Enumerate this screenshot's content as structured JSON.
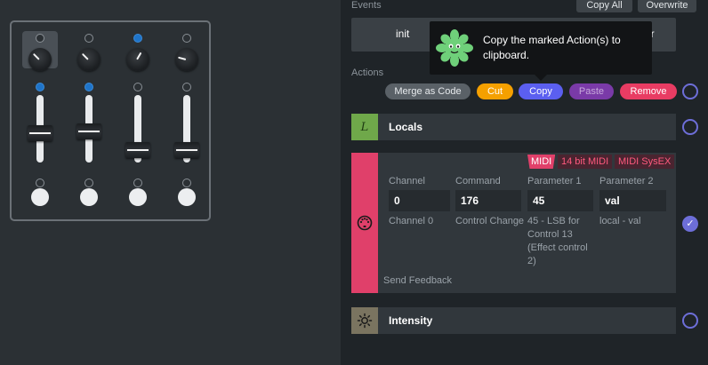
{
  "mixer": {
    "channels": [
      {
        "top_led": "off",
        "knob_angle": -135,
        "knob_selected": true,
        "fader_level": 0.45,
        "bottom_led": "off"
      },
      {
        "top_led": "off",
        "knob_angle": -135,
        "knob_selected": false,
        "fader_level": 0.42,
        "bottom_led": "off"
      },
      {
        "top_led": "on",
        "knob_angle": -60,
        "knob_selected": false,
        "fader_level": 0.15,
        "bottom_led": "off"
      },
      {
        "top_led": "off",
        "knob_angle": -165,
        "knob_selected": false,
        "fader_level": 0.15,
        "bottom_led": "off"
      }
    ],
    "fader_leds": [
      "on",
      "on",
      "off",
      "off"
    ]
  },
  "events": {
    "label": "Events",
    "copy_all_label": "Copy All",
    "overwrite_label": "Overwrite",
    "items": [
      "init",
      "timer"
    ]
  },
  "tooltip": {
    "text": "Copy the marked Action(s) to clipboard."
  },
  "actions": {
    "label": "Actions",
    "toolbar": {
      "merge_label": "Merge as Code",
      "cut_label": "Cut",
      "copy_label": "Copy",
      "paste_label": "Paste",
      "remove_label": "Remove"
    },
    "locals": {
      "title": "Locals",
      "icon": "L"
    },
    "midi": {
      "tabs": [
        "MIDI",
        "14 bit MIDI",
        "MIDI SysEX"
      ],
      "fields": [
        {
          "label": "Channel",
          "value": "0",
          "desc": "Channel 0"
        },
        {
          "label": "Command",
          "value": "176",
          "desc": "Control Change"
        },
        {
          "label": "Parameter 1",
          "value": "45",
          "desc": "45 - LSB for Control 13 (Effect control 2)"
        },
        {
          "label": "Parameter 2",
          "value": "val",
          "desc": "local - val"
        }
      ],
      "send_feedback_label": "Send Feedback"
    },
    "intensity": {
      "title": "Intensity"
    }
  },
  "colors": {
    "accent": "#6d6ed8",
    "midi": "#e0406a",
    "locals": "#6fa84a",
    "intensity": "#7a7460",
    "cut": "#f5a000",
    "copy": "#5b5ff0",
    "paste": "#7a3aa8",
    "remove": "#e83c63"
  }
}
